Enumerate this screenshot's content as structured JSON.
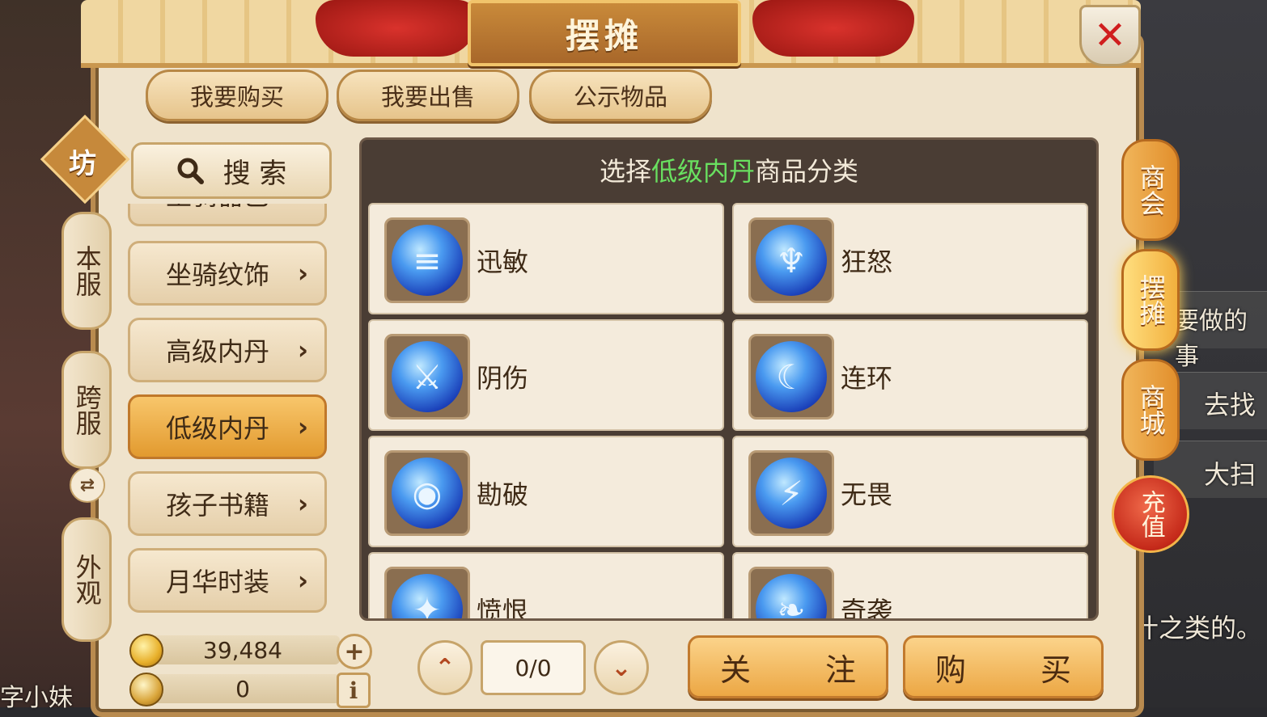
{
  "window": {
    "title": "摆摊"
  },
  "top_tabs": [
    "我要购买",
    "我要出售",
    "公示物品"
  ],
  "server_tabs": {
    "badge": "坊",
    "items": [
      "本服",
      "跨服",
      "外观"
    ]
  },
  "search_label": "搜 索",
  "categories": [
    {
      "label": "坐骑纹饰",
      "active": false
    },
    {
      "label": "高级内丹",
      "active": false
    },
    {
      "label": "低级内丹",
      "active": true
    },
    {
      "label": "孩子书籍",
      "active": false
    },
    {
      "label": "月华时装",
      "active": false
    }
  ],
  "partial_category": "坐骑器巴",
  "content_title": {
    "prefix": "选择",
    "highlight": "低级内丹",
    "suffix": "商品分类"
  },
  "items": [
    {
      "name": "迅敏",
      "icon": "swift-orb-icon"
    },
    {
      "name": "狂怒",
      "icon": "rage-orb-icon"
    },
    {
      "name": "阴伤",
      "icon": "shadow-orb-icon"
    },
    {
      "name": "连环",
      "icon": "chain-orb-icon"
    },
    {
      "name": "勘破",
      "icon": "eye-orb-icon"
    },
    {
      "name": "无畏",
      "icon": "fearless-orb-icon"
    },
    {
      "name": "愤恨",
      "icon": "hatred-orb-icon"
    },
    {
      "name": "奇袭",
      "icon": "raid-orb-icon"
    }
  ],
  "currency": {
    "gold": "39,484",
    "silver": "0"
  },
  "pager": {
    "value": "0/0"
  },
  "actions": {
    "follow": "关 注",
    "buy": "购 买"
  },
  "right_tabs": [
    "商会",
    "摆摊",
    "商城"
  ],
  "recharge": "充值",
  "background_texts": {
    "todo": "要做的事",
    "go_find": "去找",
    "sweep": "大扫",
    "note": "什之类的。",
    "npc": "字小妹"
  }
}
